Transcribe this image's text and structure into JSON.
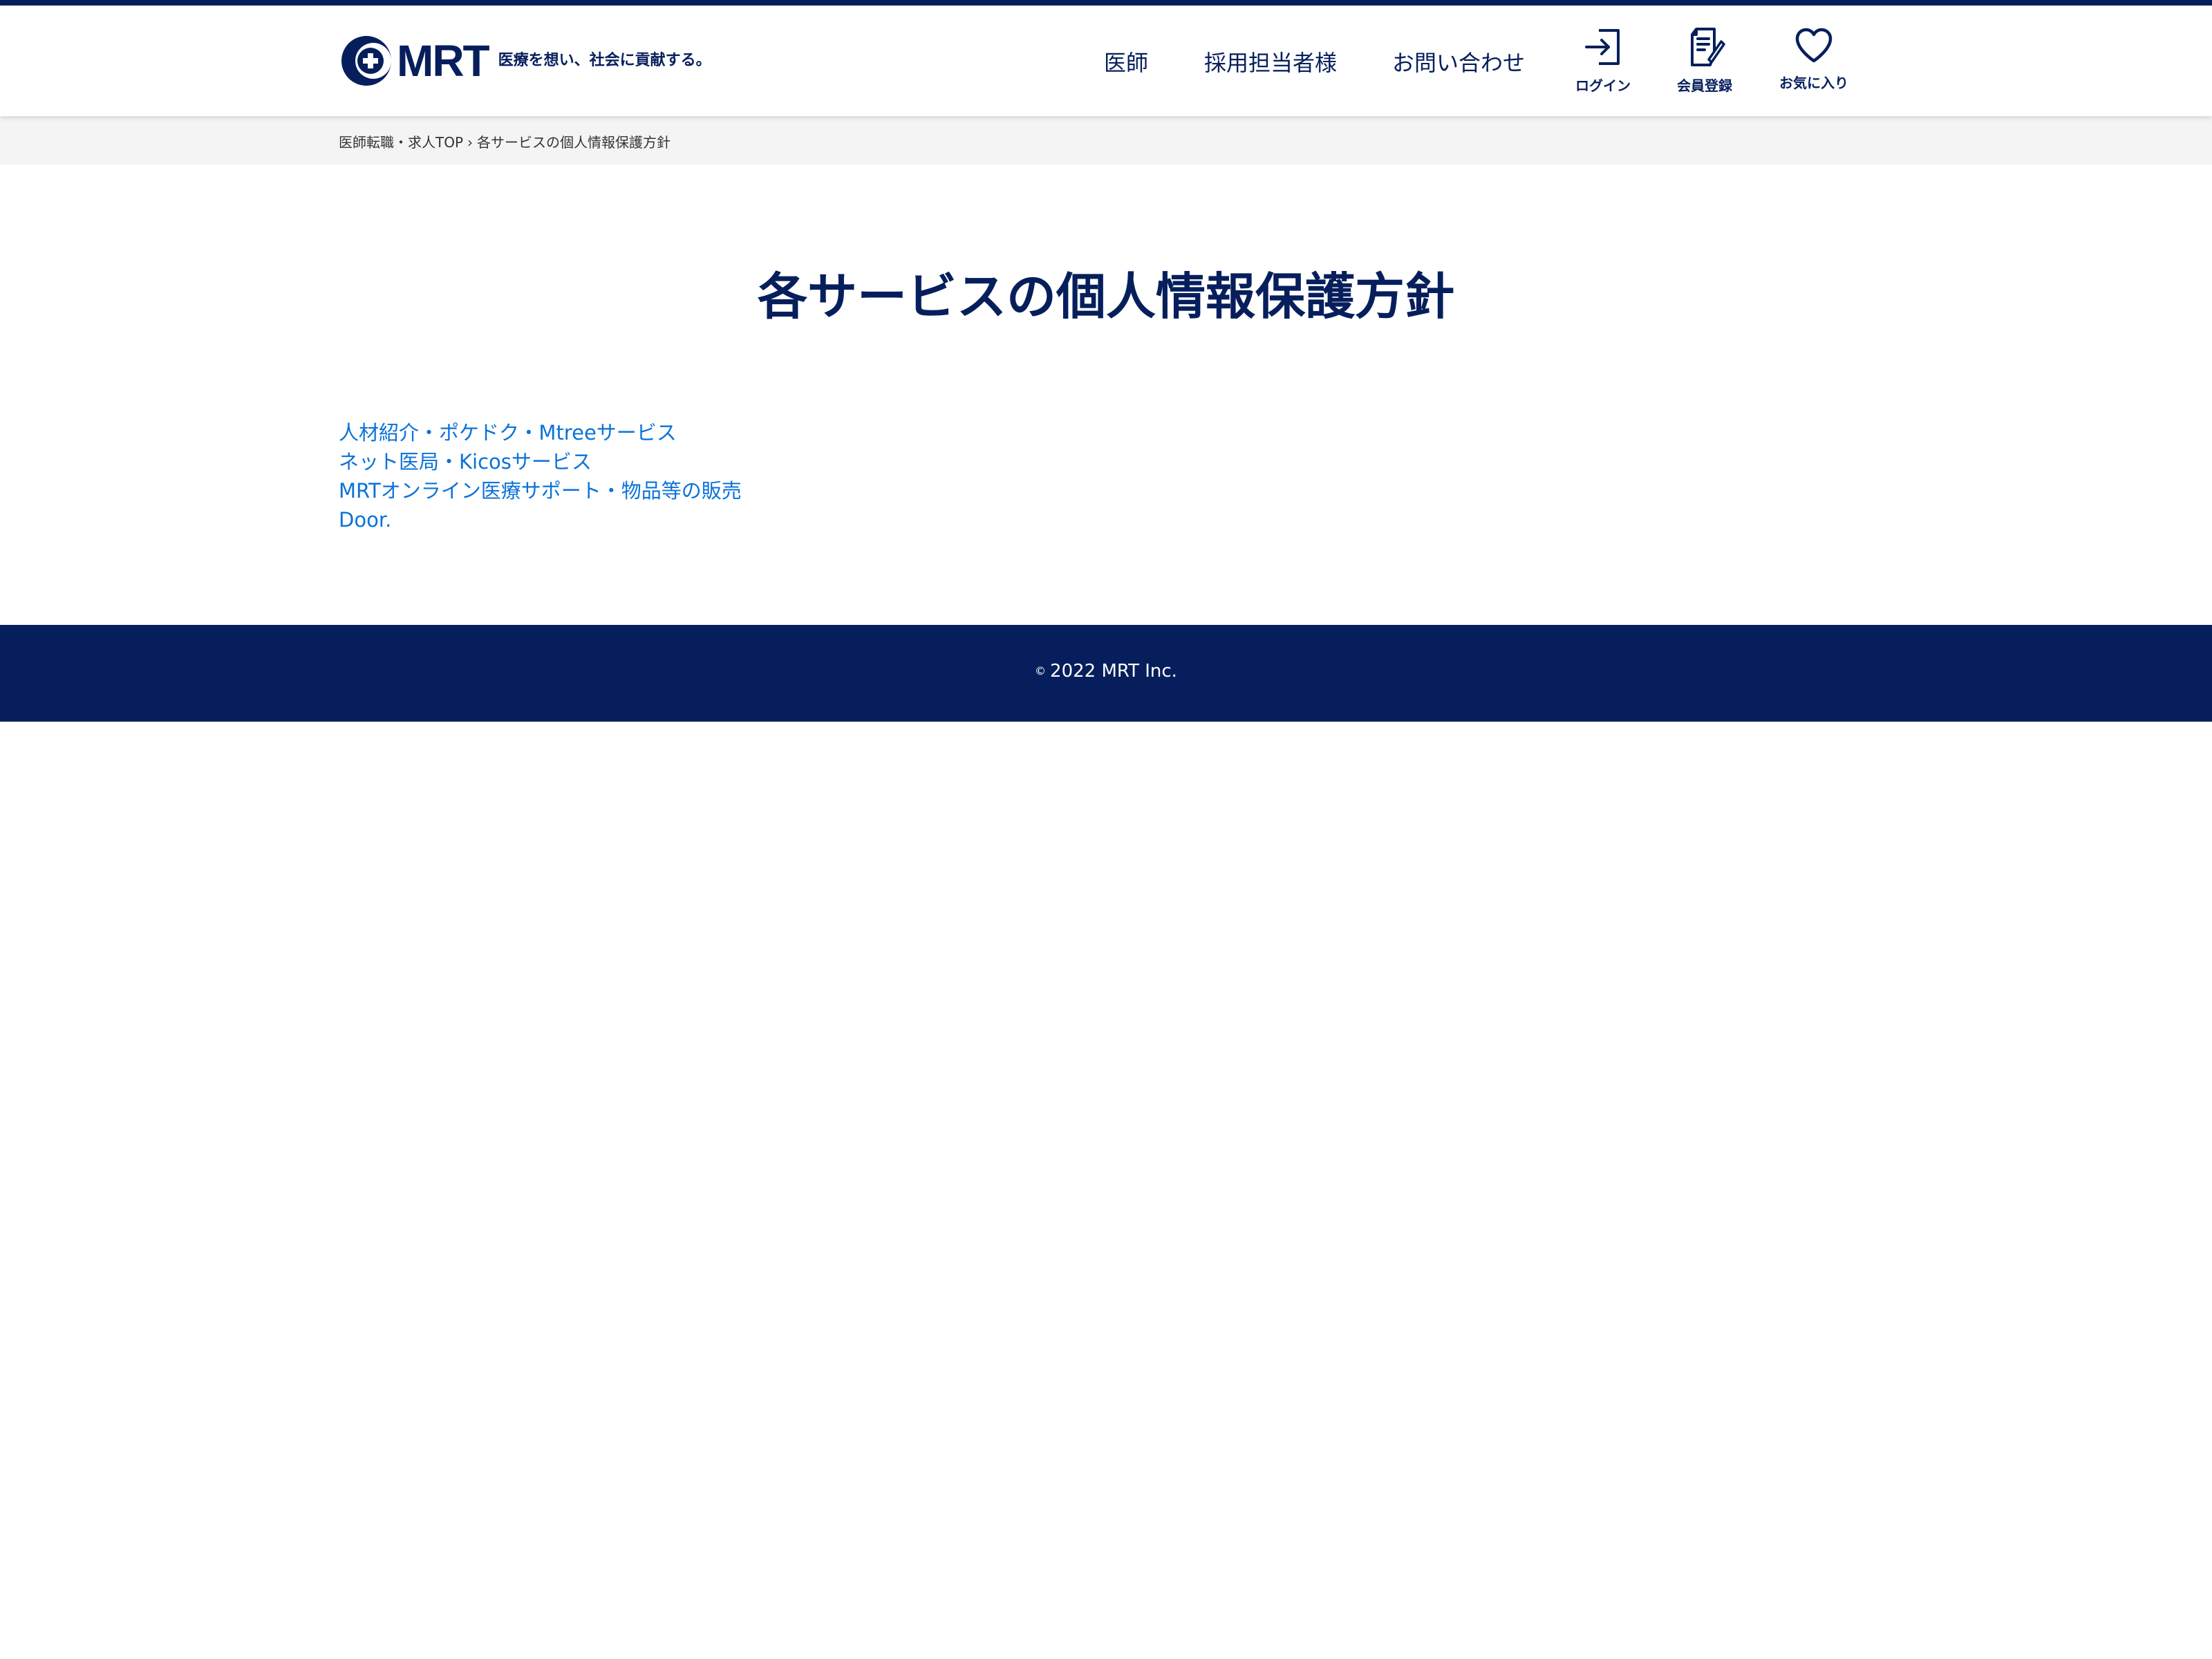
{
  "header": {
    "logo_text": "MRT",
    "tagline": "医療を想い、社会に貢献する。",
    "nav": {
      "doctor": "医師",
      "recruiter": "採用担当者様",
      "contact": "お問い合わせ"
    },
    "icon_buttons": {
      "login": {
        "label": "ログイン",
        "icon": "login-icon"
      },
      "register": {
        "label": "会員登録",
        "icon": "register-icon"
      },
      "favorites": {
        "label": "お気に入り",
        "icon": "heart-icon"
      }
    }
  },
  "breadcrumb": {
    "home": "医師転職・求人TOP",
    "separator": "›",
    "current": "各サービスの個人情報保護方針"
  },
  "main": {
    "title": "各サービスの個人情報保護方針",
    "services": [
      "人材紹介・ポケドク・Mtreeサービス",
      "ネット医局・Kicosサービス",
      "MRTオンライン医療サポート・物品等の販売",
      "Door."
    ]
  },
  "footer": {
    "copyright_mark": "©",
    "copyright": "2022 MRT Inc."
  },
  "colors": {
    "navy": "#061f5c",
    "link_blue": "#0b72d8",
    "breadcrumb_bg": "#f4f4f4"
  }
}
